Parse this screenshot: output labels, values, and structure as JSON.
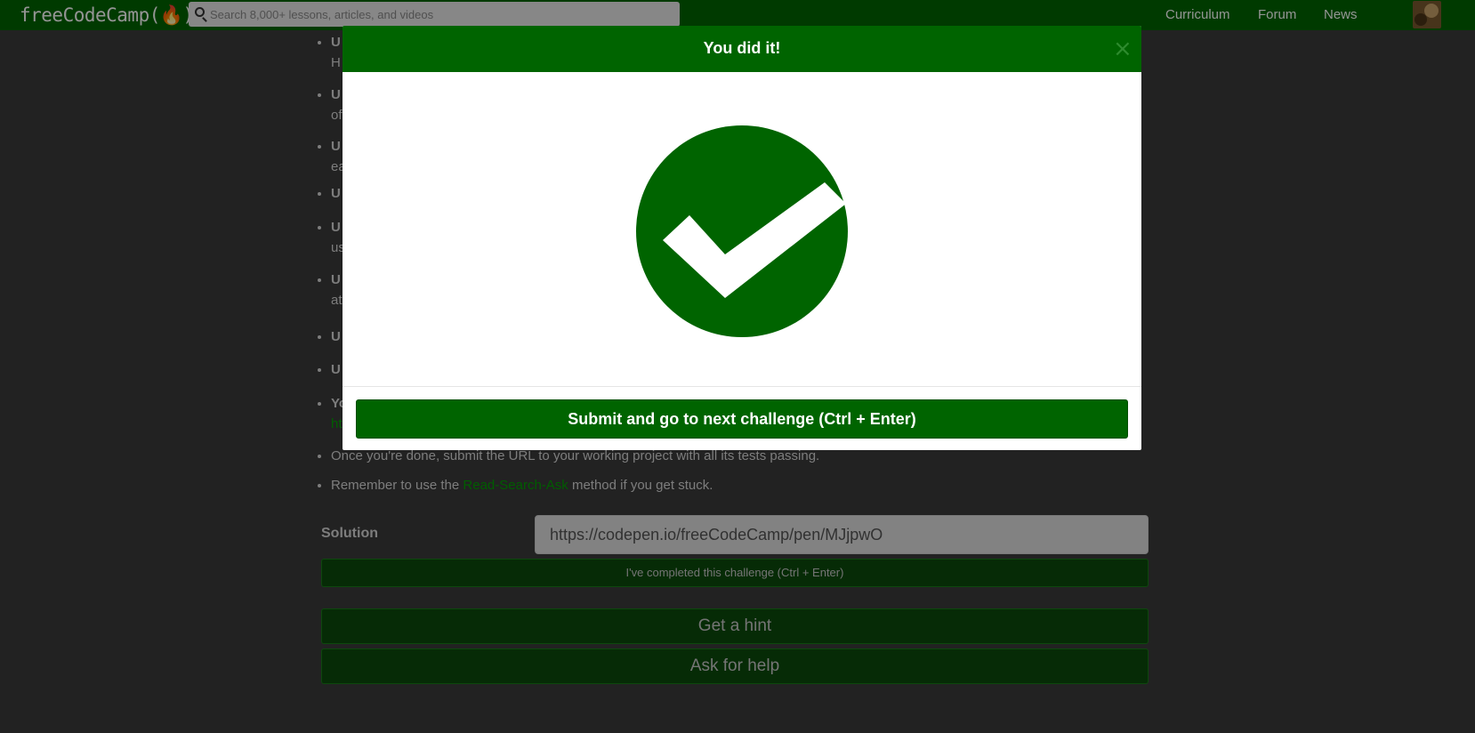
{
  "nav": {
    "logo_text": "freeCodeCamp(🔥)",
    "search_placeholder": "Search 8,000+ lessons, articles, and videos",
    "links": [
      "Curriculum",
      "Forum",
      "News"
    ]
  },
  "description": {
    "items": [
      {
        "lead": "U",
        "cont": "H"
      },
      {
        "lead": "U",
        "cont": "of"
      },
      {
        "lead": "U",
        "cont": "ea"
      },
      {
        "lead": "U",
        "cont": ""
      },
      {
        "lead": "U",
        "cont": "us"
      },
      {
        "lead": "U",
        "cont": "at"
      },
      {
        "lead": "U",
        "cont": ""
      },
      {
        "lead": "U",
        "cont": ""
      },
      {
        "lead": "Yo",
        "cont": "ht"
      }
    ],
    "done_text": "Once you're done, submit the URL to your working project with all its tests passing.",
    "remember_before": "Remember to use the ",
    "remember_link": "Read-Search-Ask",
    "remember_after": " method if you get stuck."
  },
  "solution": {
    "label": "Solution",
    "value": "https://codepen.io/freeCodeCamp/pen/MJjpwO"
  },
  "buttons": {
    "complete": "I've completed this challenge (Ctrl + Enter)",
    "hint": "Get a hint",
    "help": "Ask for help"
  },
  "modal": {
    "title": "You did it!",
    "close": "×",
    "submit": "Submit and go to next challenge (Ctrl + Enter)"
  },
  "colors": {
    "brand_green": "#006400",
    "background": "#3b3b3b",
    "link_green": "#00a000"
  },
  "icons": [
    "search-icon",
    "close-icon",
    "check-circle-icon"
  ]
}
